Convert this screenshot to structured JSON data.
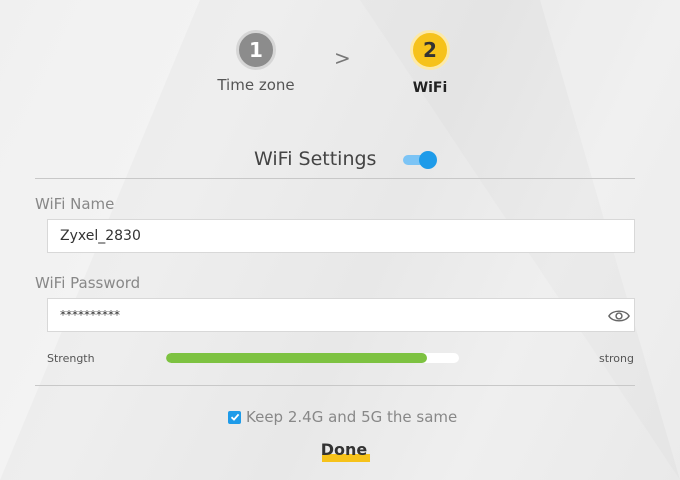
{
  "wizard": {
    "steps": [
      {
        "number": "1",
        "label": "Time zone",
        "state": "done"
      },
      {
        "number": "2",
        "label": "WiFi",
        "state": "active"
      }
    ],
    "separator": ">"
  },
  "wifi_settings": {
    "title": "WiFi Settings",
    "enabled": true,
    "name_label": "WiFi Name",
    "name_value": "Zyxel_2830",
    "password_label": "WiFi Password",
    "password_value": "**********",
    "strength_label": "Strength",
    "strength_value": "strong",
    "strength_level": 0.89,
    "same_bands_label": "Keep 2.4G and 5G the same",
    "same_bands_checked": true,
    "done_label": "Done"
  },
  "colors": {
    "accent": "#f6c21a",
    "toggle_on": "#1e9be9",
    "strength_fill": "#7dc241"
  }
}
